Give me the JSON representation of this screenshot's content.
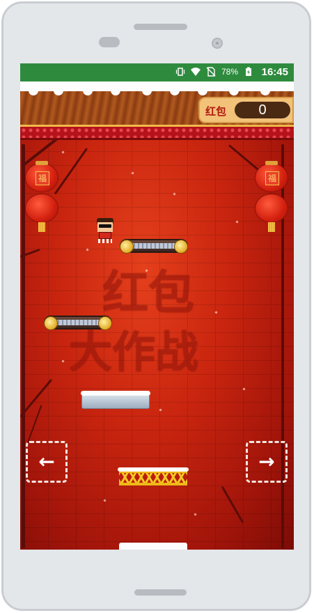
{
  "status_bar": {
    "battery": "78%",
    "time": "16:45",
    "icons": [
      "vibrate-icon",
      "wifi-icon",
      "no-sim-icon",
      "battery-charging-icon"
    ]
  },
  "hud": {
    "score_label": "红包",
    "score_value": "0"
  },
  "decorations": {
    "lantern_glyph": "福",
    "watermark_line1": "红包",
    "watermark_line2": "大作战"
  },
  "controls": {
    "left_arrow": "←",
    "right_arrow": "→"
  },
  "colors": {
    "status_bar": "#2e8b3e",
    "background": "#c9250f",
    "score_panel": "#f2c27a"
  }
}
